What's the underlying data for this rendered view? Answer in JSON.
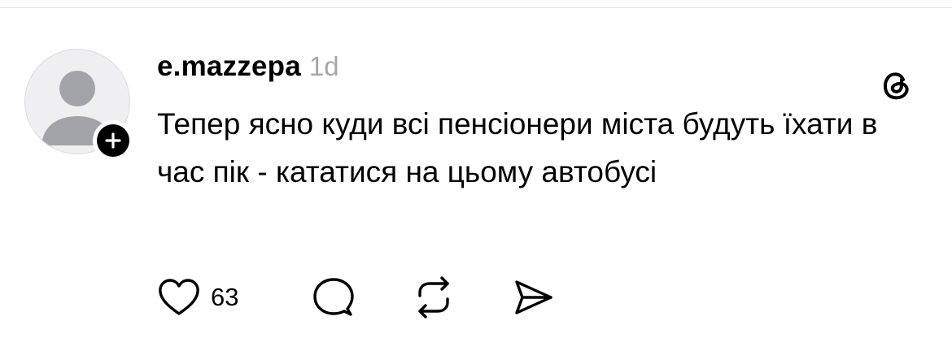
{
  "post": {
    "username": "e.mazzepa",
    "timestamp": "1d",
    "text": "Тепер ясно куди всі пенсіонери міста будуть їхати в час пік - кататися на цьому автобусі",
    "like_count": "63"
  },
  "icons": {
    "avatar": "default-avatar-icon",
    "follow": "plus-icon",
    "app": "threads-logo-icon",
    "like": "heart-icon",
    "comment": "comment-bubble-icon",
    "repost": "repost-icon",
    "share": "send-icon"
  },
  "colors": {
    "text": "#000000",
    "muted": "#a7a7a7",
    "avatar_bg": "#efeff1",
    "avatar_figure": "#a3a4aa"
  }
}
